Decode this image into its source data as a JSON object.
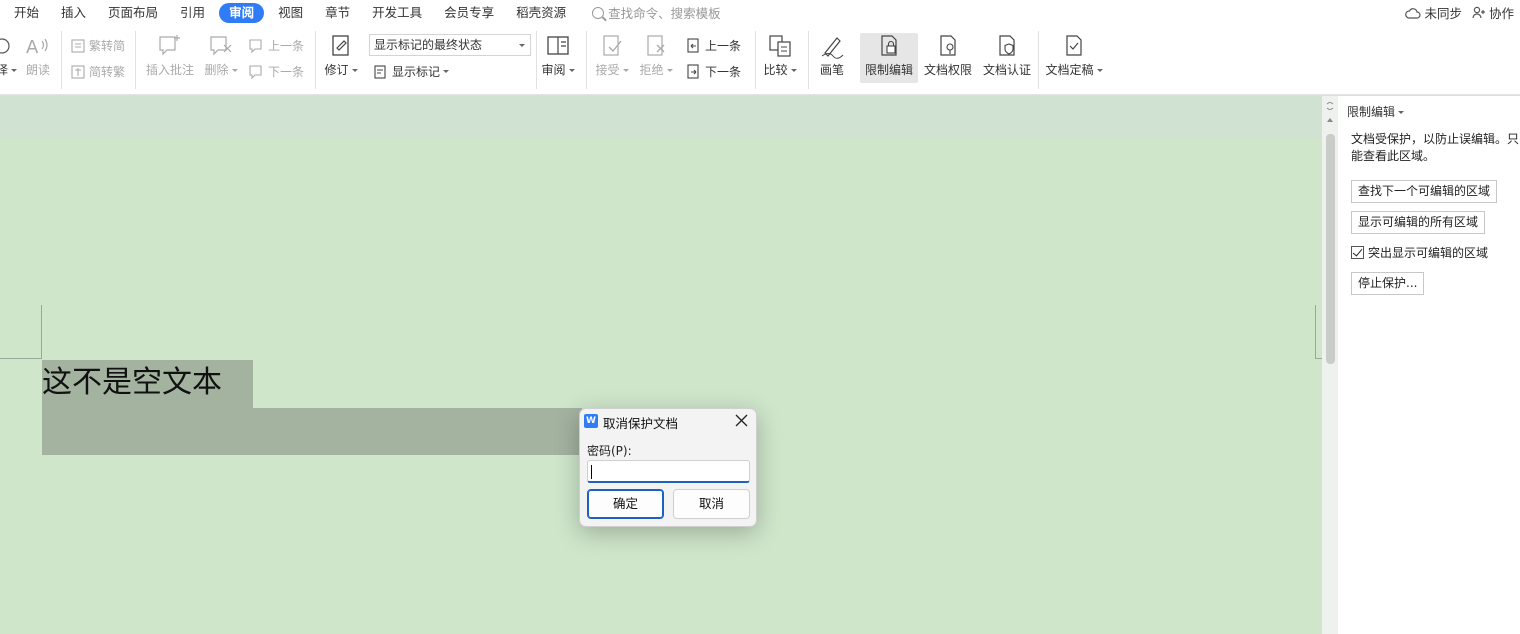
{
  "menubar": {
    "items": [
      "开始",
      "插入",
      "页面布局",
      "引用",
      "审阅",
      "视图",
      "章节",
      "开发工具",
      "会员专享",
      "稻壳资源"
    ],
    "active_index": 4,
    "search_placeholder": "查找命令、搜索模板",
    "sync_label": "未同步",
    "collab_label": "协作"
  },
  "ribbon": {
    "cut_left_label": "译",
    "read_aloud": "朗读",
    "to_traditional": "繁转简",
    "to_simplified": "简转繁",
    "insert_comment": "插入批注",
    "delete": "删除",
    "prev_comment": "上一条",
    "next_comment": "下一条",
    "revise": "修订",
    "markup_state": "显示标记的最终状态",
    "show_markup": "显示标记",
    "review": "审阅",
    "accept": "接受",
    "reject": "拒绝",
    "prev_change": "上一条",
    "next_change": "下一条",
    "compare": "比较",
    "pen": "画笔",
    "restrict_edit": "限制编辑",
    "doc_permission": "文档权限",
    "doc_cert": "文档认证",
    "finalize": "文档定稿"
  },
  "document": {
    "text": "这不是空文本"
  },
  "pane": {
    "title": "限制编辑",
    "description": "文档受保护，以防止误编辑。只能查看此区域。",
    "find_next": "查找下一个可编辑的区域",
    "show_all": "显示可编辑的所有区域",
    "highlight_label": "突出显示可编辑的区域",
    "highlight_checked": true,
    "stop_protect": "停止保护..."
  },
  "dialog": {
    "title": "取消保护文档",
    "logo": "W",
    "password_label": "密码(P):",
    "password_value": "",
    "ok": "确定",
    "cancel": "取消"
  }
}
